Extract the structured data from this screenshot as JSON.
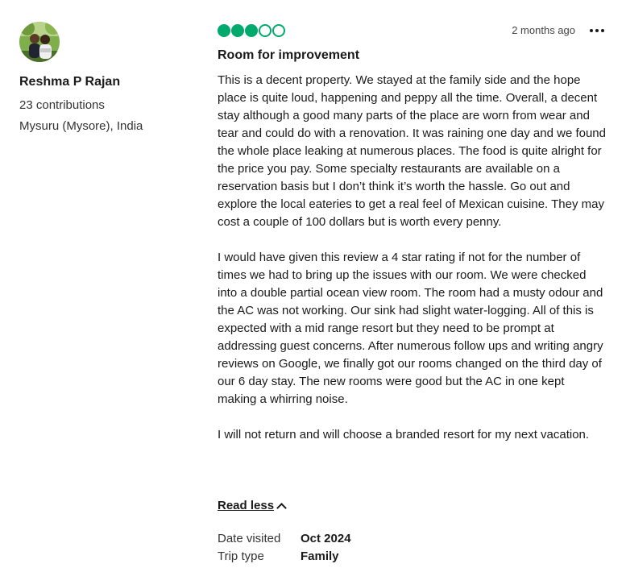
{
  "author": {
    "name": "Reshma P Rajan",
    "contributions": "23 contributions",
    "location": "Mysuru (Mysore), India"
  },
  "review": {
    "rating": 3,
    "rating_max": 5,
    "date_posted": "2 months ago",
    "title": "Room for improvement",
    "paragraphs": [
      "This is a decent property. We stayed at the family side and the hope place is quite loud, happening and peppy all the time. Overall, a decent stay although a good many parts of the place are worn from wear and tear and could do with a renovation. It was raining one day and we found the whole place leaking at numerous places. The food is quite alright for the price you pay. Some specialty restaurants are available on a reservation basis but I don’t think it’s worth the hassle. Go out and explore the local eateries to get a real feel of Mexican cuisine. They may cost a couple of 100 dollars but is worth every penny.",
      "I would have given this review a 4 star rating if not for the number of times we had to bring up the issues with our room. We were checked into a double partial ocean view room. The room had a musty odour and the AC was not working. Our sink had slight water-logging. All of this is expected with a mid range resort but they need to be prompt at addressing guest concerns. After numerous follow ups and writing angry reviews on Google, we finally got our rooms changed on the third day of our 6 day stay. The new rooms were good but the AC in one kept making a whirring noise.",
      "I will not return and will choose a branded resort for my next vacation."
    ],
    "read_less_label": "Read less",
    "date_visited_label": "Date visited",
    "date_visited": "Oct 2024",
    "trip_type_label": "Trip type",
    "trip_type": "Family"
  },
  "colors": {
    "rating_green": "#00aa6c",
    "text": "#1a1a1a"
  },
  "icons": {
    "more": "more-options-icon",
    "chevron": "chevron-up-icon"
  }
}
